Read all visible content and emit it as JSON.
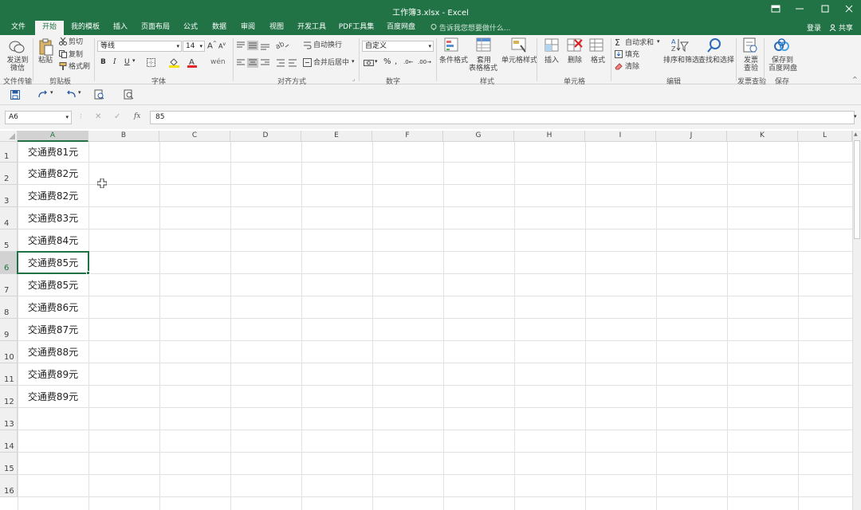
{
  "window": {
    "title": "工作簿3.xlsx - Excel",
    "controls": [
      "ribbon-display",
      "minimize",
      "maximize",
      "close"
    ]
  },
  "tabs": [
    {
      "label": "文件",
      "active": false
    },
    {
      "label": "开始",
      "active": true
    },
    {
      "label": "我的模板",
      "active": false
    },
    {
      "label": "插入",
      "active": false
    },
    {
      "label": "页面布局",
      "active": false
    },
    {
      "label": "公式",
      "active": false
    },
    {
      "label": "数据",
      "active": false
    },
    {
      "label": "审阅",
      "active": false
    },
    {
      "label": "视图",
      "active": false
    },
    {
      "label": "开发工具",
      "active": false
    },
    {
      "label": "PDF工具集",
      "active": false
    },
    {
      "label": "百度网盘",
      "active": false
    }
  ],
  "tell_me": "告诉我您想要做什么...",
  "account": {
    "login": "登录",
    "share": "共享"
  },
  "ribbon": {
    "send_wechat": "发送到微信",
    "group_file_transfer": "文件传输",
    "paste": "粘贴",
    "cut": "剪切",
    "copy": "复制",
    "format_painter": "格式刷",
    "group_clipboard": "剪贴板",
    "font_name": "等线",
    "font_size": "14",
    "bold": "B",
    "italic": "I",
    "underline": "U",
    "group_font": "字体",
    "wrap_text": "自动换行",
    "merge_center": "合并后居中",
    "group_alignment": "对齐方式",
    "number_format": "自定义",
    "percent": "%",
    "group_number": "数字",
    "conditional_format": "条件格式",
    "table_format_1": "套用",
    "table_format_2": "表格格式",
    "cell_styles": "单元格样式",
    "group_styles": "样式",
    "insert": "插入",
    "delete": "删除",
    "format": "格式",
    "group_cells": "单元格",
    "autosum": "自动求和",
    "fill": "填充",
    "clear": "清除",
    "sort_filter": "排序和筛选",
    "find_select": "查找和选择",
    "group_editing": "编辑",
    "invoice_check_1": "发票",
    "invoice_check_2": "查验",
    "group_invoice": "发票查验",
    "save_baidu_1": "保存到",
    "save_baidu_2": "百度网盘",
    "group_save": "保存"
  },
  "formula_bar": {
    "name_box": "A6",
    "fx": "fx",
    "value": "85"
  },
  "columns": [
    "A",
    "B",
    "C",
    "D",
    "E",
    "F",
    "G",
    "H",
    "I",
    "J",
    "K",
    "L"
  ],
  "rows": [
    "1",
    "2",
    "3",
    "4",
    "5",
    "6",
    "7",
    "8",
    "9",
    "10",
    "11",
    "12",
    "13",
    "14",
    "15",
    "16"
  ],
  "cells_a": [
    "交通费81元",
    "交通费82元",
    "交通费82元",
    "交通费83元",
    "交通费84元",
    "交通费85元",
    "交通费85元",
    "交通费86元",
    "交通费87元",
    "交通费88元",
    "交通费89元",
    "交通费89元"
  ],
  "selected_cell": {
    "column": "A",
    "row": "6"
  },
  "colors": {
    "accent": "#217346",
    "ribbon": "#f3f3f3",
    "grid_line": "#e1e1e1"
  }
}
